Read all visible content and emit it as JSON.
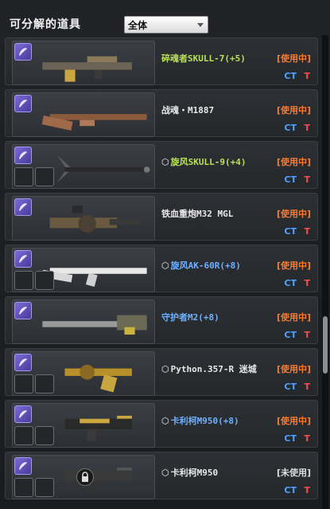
{
  "header": {
    "title": "可分解的道具",
    "filter_value": "全体"
  },
  "colors": {
    "name_green": "#b8e05a",
    "name_white": "#e8e8e8",
    "name_blue": "#6fb0ff",
    "status_in_use": "#ff7a2e",
    "status_unused": "#dddddd",
    "ct": "#4fa3ff",
    "t": "#ff4b4b"
  },
  "items": [
    {
      "name": "碎魂者SKULL-7(+5)",
      "mark": "",
      "name_color": "#b8e05a",
      "status": "[使用中]",
      "status_color": "#ff7a2e",
      "ct": "CT",
      "t": "T",
      "slots": false,
      "locked": false,
      "grade_icon": "feather-icon"
    },
    {
      "name": "战魂・M1887",
      "mark": "",
      "name_color": "#e8e8e8",
      "status": "[使用中]",
      "status_color": "#ff7a2e",
      "ct": "CT",
      "t": "T",
      "slots": false,
      "locked": false,
      "grade_icon": "feather-icon"
    },
    {
      "name": "旋风SKULL-9(+4)",
      "mark": "⬡",
      "name_color": "#b8e05a",
      "status": "[使用中]",
      "status_color": "#ff7a2e",
      "ct": "CT",
      "t": "T",
      "slots": true,
      "locked": false,
      "grade_icon": "feather-icon"
    },
    {
      "name": "铁血重炮M32 MGL",
      "mark": "",
      "name_color": "#e8e8e8",
      "status": "[使用中]",
      "status_color": "#ff7a2e",
      "ct": "CT",
      "t": "T",
      "slots": false,
      "locked": false,
      "grade_icon": "feather-icon"
    },
    {
      "name": "旋风AK-60R(+8)",
      "mark": "⬡",
      "name_color": "#6fb0ff",
      "status": "[使用中]",
      "status_color": "#ff7a2e",
      "ct": "CT",
      "t": "T",
      "slots": true,
      "locked": false,
      "grade_icon": "feather-icon"
    },
    {
      "name": "守护者M2(+8)",
      "mark": "",
      "name_color": "#6fb0ff",
      "status": "[使用中]",
      "status_color": "#ff7a2e",
      "ct": "CT",
      "t": "T",
      "slots": false,
      "locked": false,
      "grade_icon": "feather-icon"
    },
    {
      "name": "Python.357-R 迷城",
      "mark": "⬡",
      "name_color": "#e8e8e8",
      "status": "[使用中]",
      "status_color": "#ff7a2e",
      "ct": "CT",
      "t": "T",
      "slots": true,
      "locked": false,
      "grade_icon": "feather-icon"
    },
    {
      "name": "卡利柯M950(+8)",
      "mark": "⬡",
      "name_color": "#6fb0ff",
      "status": "[使用中]",
      "status_color": "#ff7a2e",
      "ct": "CT",
      "t": "T",
      "slots": true,
      "locked": false,
      "grade_icon": "feather-icon"
    },
    {
      "name": "卡利柯M950",
      "mark": "⬡",
      "name_color": "#e8e8e8",
      "status": "[未使用]",
      "status_color": "#dddddd",
      "ct": "CT",
      "t": "T",
      "slots": true,
      "locked": true,
      "grade_icon": "feather-icon"
    }
  ]
}
